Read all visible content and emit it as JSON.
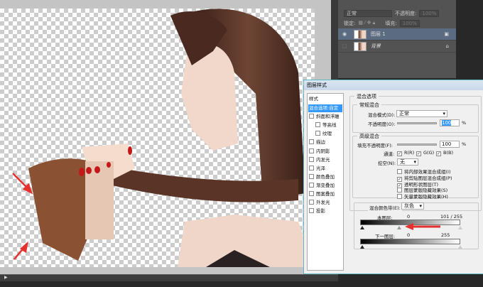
{
  "layers_panel": {
    "blend_mode": "正常",
    "opacity_label": "不透明度:",
    "opacity_value": "100%",
    "lock_label": "锁定:",
    "fill_label": "填充:",
    "fill_value": "100%",
    "layers": [
      {
        "name": "图层 1",
        "selected": true,
        "visible": true
      },
      {
        "name": "背景",
        "selected": false,
        "visible": false
      }
    ]
  },
  "dialog": {
    "title": "图层样式",
    "styles_header": "样式",
    "style_items": [
      {
        "label": "混合选项:自定",
        "selected": true
      },
      {
        "label": "斜面和浮雕",
        "checked": false
      },
      {
        "label": "等高线",
        "checked": false,
        "sub": true
      },
      {
        "label": "纹理",
        "checked": false,
        "sub": true
      },
      {
        "label": "描边",
        "checked": false
      },
      {
        "label": "内阴影",
        "checked": false
      },
      {
        "label": "内发光",
        "checked": false
      },
      {
        "label": "光泽",
        "checked": false
      },
      {
        "label": "颜色叠加",
        "checked": false
      },
      {
        "label": "渐变叠加",
        "checked": false
      },
      {
        "label": "图案叠加",
        "checked": false
      },
      {
        "label": "外发光",
        "checked": false
      },
      {
        "label": "投影",
        "checked": false
      }
    ],
    "blend_options": {
      "title": "混合选项",
      "general_title": "常规混合",
      "blend_mode_label": "混合模式(D):",
      "blend_mode_value": "正常",
      "opacity_label": "不透明度(O):",
      "opacity_value": "100",
      "percent": "%",
      "advanced_title": "高级混合",
      "fill_opacity_label": "填充不透明度(F):",
      "fill_opacity_value": "100",
      "channels_label": "通道:",
      "channels": [
        "R(R)",
        "G(G)",
        "B(B)"
      ],
      "knockout_label": "挖空(N):",
      "knockout_value": "无",
      "checks": [
        {
          "label": "将内部效果混合成组(I)",
          "checked": false
        },
        {
          "label": "将剪贴图层混合成组(P)",
          "checked": true
        },
        {
          "label": "透明形状图层(T)",
          "checked": true
        },
        {
          "label": "图层蒙版隐藏效果(S)",
          "checked": false
        },
        {
          "label": "矢量蒙版隐藏效果(H)",
          "checked": false
        }
      ],
      "blend_if_label": "混合颜色带(E):",
      "blend_if_value": "灰色",
      "this_layer_label": "本图层:",
      "this_layer_low": "0",
      "this_layer_high": "101 / 255",
      "underlying_label": "下一图层:",
      "underlying_low": "0",
      "underlying_high": "255"
    }
  },
  "colors": {
    "arrow": "#e53030",
    "selection": "#3399ff",
    "hair": "#5a3527"
  }
}
